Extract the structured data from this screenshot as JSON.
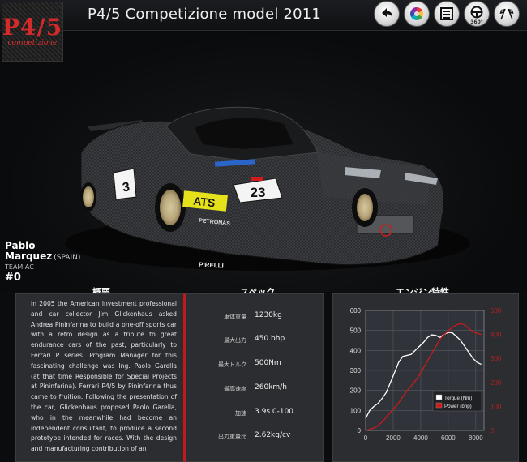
{
  "header": {
    "logo_main": "P4/5",
    "logo_sub": "competizione",
    "title": "P4/5 Competizione model 2011",
    "buttons": [
      {
        "name": "back-button",
        "icon": "back-arrow-icon",
        "label": ""
      },
      {
        "name": "color-button",
        "icon": "color-wheel-icon",
        "label": ""
      },
      {
        "name": "garage-button",
        "icon": "garage-icon",
        "label": ""
      },
      {
        "name": "view-360-button",
        "icon": "steering-wheel-icon",
        "label": "360°"
      },
      {
        "name": "race-button",
        "icon": "checkered-flags-icon",
        "label": ""
      }
    ]
  },
  "car": {
    "race_number": "23",
    "sponsor": "ATS",
    "sponsor2": "PETRONAS",
    "sponsor3": "PIRELLI"
  },
  "driver": {
    "first_name": "Pablo",
    "last_name": "Marquez",
    "country": "(SPAIN)",
    "team": "TEAM AC",
    "number": "#0"
  },
  "sections": {
    "about_title": "概要",
    "specs_title": "スペック",
    "engine_title": "エンジン特性"
  },
  "about_text": "In 2005 the American investment professional and car collector Jim Glickenhaus asked Andrea Pininfarina to build a one-off sports car with a retro design as a tribute to great endurance cars of the past, particularly to Ferrari P series. Program Manager for this fascinating challenge was Ing. Paolo Garella (at that time Responsible for Special Projects at Pininfarina). Ferrari P4/5 by Pininfarina thus came to fruition. Following the presentation of the car, Glickenhaus proposed Paolo Garella, who in the meanwhile had become an independent consultant, to produce a second prototype intended for races. With the design and manufacturing contribution of an",
  "specs": [
    {
      "key": "車体重量",
      "value": "1230kg"
    },
    {
      "key": "最大出力",
      "value": "450 bhp"
    },
    {
      "key": "最大トルク",
      "value": "500Nm"
    },
    {
      "key": "最高速度",
      "value": "260km/h"
    },
    {
      "key": "加速",
      "value": "3.9s 0-100"
    },
    {
      "key": "出力重量比",
      "value": "2.62kg/cv"
    }
  ],
  "chart_data": {
    "type": "line",
    "x_ticks": [
      "0",
      "2000",
      "4000",
      "6000",
      "8000"
    ],
    "xlim": [
      0,
      8600
    ],
    "y_left_ticks": [
      "0",
      "100",
      "200",
      "300",
      "400",
      "500",
      "600"
    ],
    "ylim_left": [
      0,
      600
    ],
    "y_right_ticks": [
      "0",
      "100",
      "200",
      "300",
      "400",
      "500"
    ],
    "ylim_right": [
      0,
      500
    ],
    "legend_position": "bottom-right",
    "grid": true,
    "series": [
      {
        "name": "Torque (Nm)",
        "color": "#ffffff",
        "axis": "left",
        "x": [
          0,
          300,
          600,
          900,
          1200,
          1500,
          1800,
          2100,
          2400,
          2700,
          3000,
          3300,
          3600,
          3900,
          4200,
          4500,
          4800,
          5100,
          5400,
          5700,
          6000,
          6300,
          6600,
          6900,
          7200,
          7500,
          7800,
          8100,
          8400
        ],
        "y": [
          60,
          100,
          120,
          135,
          160,
          190,
          240,
          290,
          340,
          370,
          375,
          380,
          400,
          420,
          440,
          465,
          478,
          475,
          465,
          480,
          490,
          488,
          470,
          450,
          420,
          390,
          360,
          340,
          330
        ]
      },
      {
        "name": "Power (bhp)",
        "color": "#cc1a1a",
        "axis": "right",
        "x": [
          0,
          300,
          600,
          900,
          1200,
          1500,
          1800,
          2100,
          2400,
          2700,
          3000,
          3300,
          3600,
          3900,
          4200,
          4500,
          4800,
          5100,
          5400,
          5700,
          6000,
          6300,
          6600,
          6900,
          7200,
          7500,
          7800,
          8100,
          8400
        ],
        "y": [
          0,
          5,
          10,
          20,
          35,
          55,
          75,
          95,
          115,
          140,
          165,
          185,
          205,
          230,
          260,
          290,
          320,
          350,
          380,
          400,
          415,
          430,
          440,
          445,
          440,
          425,
          410,
          405,
          400
        ]
      }
    ]
  }
}
